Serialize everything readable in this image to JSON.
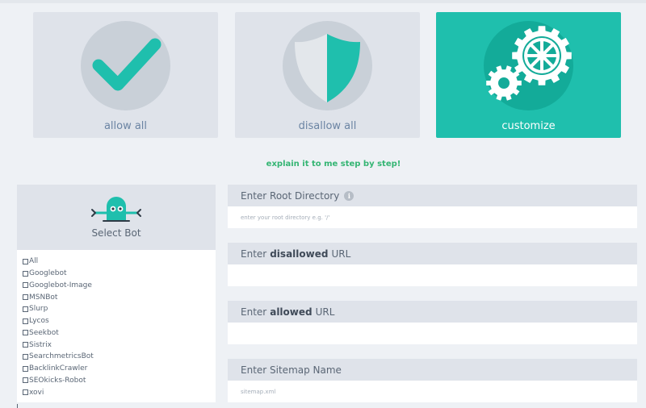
{
  "modes": {
    "allow": {
      "label": "allow all",
      "icon": "checkmark-icon"
    },
    "disallow": {
      "label": "disallow all",
      "icon": "shield-icon"
    },
    "customize": {
      "label": "customize",
      "icon": "gears-icon",
      "selected": true
    }
  },
  "explain_link": "explain it to me step by step!",
  "bot_panel": {
    "title": "Select Bot",
    "icon": "robot-icon",
    "bots": [
      "All",
      "Googlebot",
      "Googlebot-Image",
      "MSNBot",
      "Slurp",
      "Lycos",
      "Seekbot",
      "Sistrix",
      "SearchmetricsBot",
      "BacklinkCrawler",
      "SEOkicks-Robot",
      "xovi"
    ]
  },
  "fields": {
    "root": {
      "label": "Enter Root Directory",
      "placeholder": "enter your root directory e.g. '/'",
      "value": ""
    },
    "disallowed": {
      "prefix": "Enter",
      "strong": "disallowed",
      "suffix": "URL",
      "value": ""
    },
    "allowed": {
      "prefix": "Enter",
      "strong": "allowed",
      "suffix": "URL",
      "value": ""
    },
    "sitemap": {
      "label": "Enter Sitemap Name",
      "placeholder": "sitemap.xml",
      "value": ""
    }
  },
  "colors": {
    "accent": "#1fbfad",
    "accent_dark": "#13ab99",
    "link": "#34b573",
    "panel_gray": "#dfe3ea",
    "background": "#eef1f5"
  }
}
